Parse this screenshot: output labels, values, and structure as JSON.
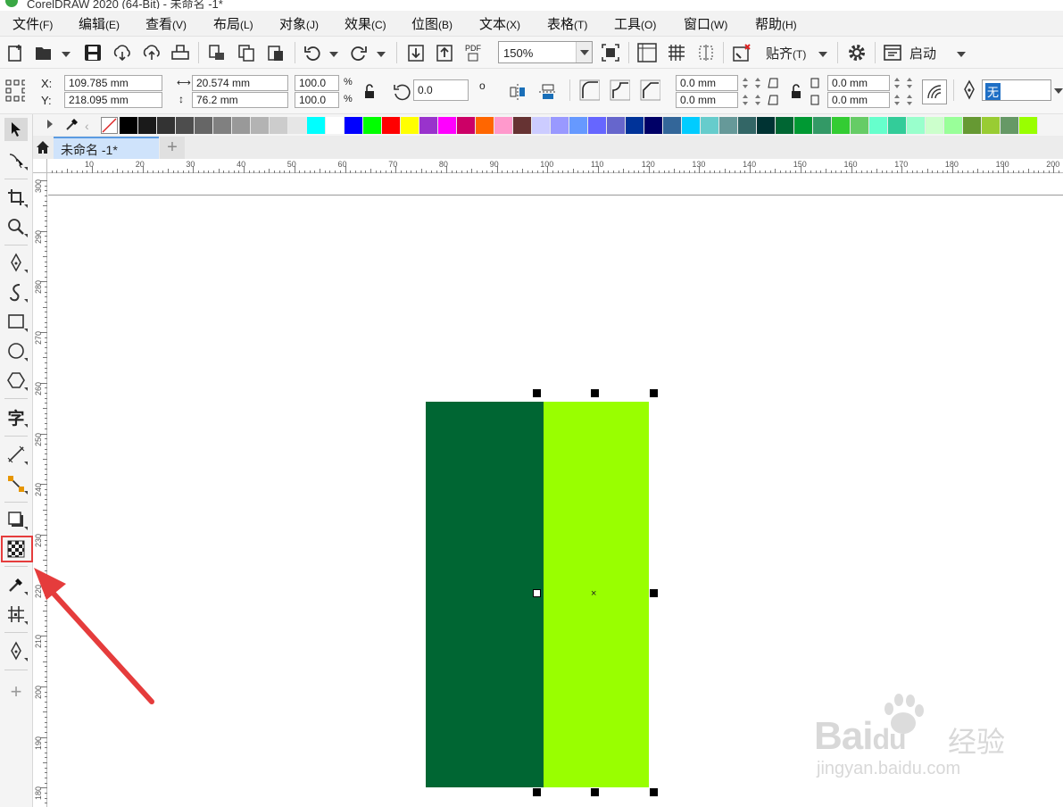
{
  "app": {
    "window_title": "CorelDRAW 2020 (64-Bit) - 未命名 -1*"
  },
  "menu": [
    {
      "label": "文件",
      "accel": "(F)"
    },
    {
      "label": "编辑",
      "accel": "(E)"
    },
    {
      "label": "查看",
      "accel": "(V)"
    },
    {
      "label": "布局",
      "accel": "(L)"
    },
    {
      "label": "对象",
      "accel": "(J)"
    },
    {
      "label": "效果",
      "accel": "(C)"
    },
    {
      "label": "位图",
      "accel": "(B)"
    },
    {
      "label": "文本",
      "accel": "(X)"
    },
    {
      "label": "表格",
      "accel": "(T)"
    },
    {
      "label": "工具",
      "accel": "(O)"
    },
    {
      "label": "窗口",
      "accel": "(W)"
    },
    {
      "label": "帮助",
      "accel": "(H)"
    }
  ],
  "toolbar": {
    "zoom_level": "150%",
    "snap_label": "贴齐",
    "snap_accel": "(T)",
    "launch_label": "启动",
    "pdf_label": "PDF"
  },
  "property_bar": {
    "x_label": "X:",
    "y_label": "Y:",
    "x_value": "109.785 mm",
    "y_value": "218.095 mm",
    "width_value": "20.574 mm",
    "height_value": "76.2 mm",
    "scale_x": "100.0",
    "scale_y": "100.0",
    "percent": "%",
    "rotation": "0.0",
    "degree_symbol": "o",
    "corner_1": "0.0 mm",
    "corner_2": "0.0 mm",
    "corner_3": "0.0 mm",
    "corner_4": "0.0 mm",
    "outline_value": "无"
  },
  "palette": [
    "#000000",
    "#1a1a1a",
    "#333333",
    "#4d4d4d",
    "#666666",
    "#808080",
    "#999999",
    "#b3b3b3",
    "#cccccc",
    "#e6e6e6",
    "#00ffff",
    "#ffffff",
    "#0000ff",
    "#00ff00",
    "#ff0000",
    "#ffff00",
    "#9933cc",
    "#ff00ff",
    "#cc0066",
    "#ff6600",
    "#ff99cc",
    "#663333",
    "#ccccff",
    "#9999ff",
    "#6699ff",
    "#6666ff",
    "#6666cc",
    "#003399",
    "#000066",
    "#336699",
    "#00ccff",
    "#66cccc",
    "#669999",
    "#336666",
    "#003333",
    "#006633",
    "#009933",
    "#339966",
    "#33cc33",
    "#66cc66",
    "#66ffcc",
    "#33cc99",
    "#99ffcc",
    "#ccffcc",
    "#99ff99",
    "#669933",
    "#99cc33",
    "#669966",
    "#99ff00"
  ],
  "document_tab": {
    "title": "未命名 -1*"
  },
  "ruler": {
    "h_labels": [
      "10",
      "20",
      "30",
      "40",
      "50",
      "60",
      "70",
      "80",
      "90",
      "100",
      "110",
      "120",
      "130",
      "140",
      "150",
      "160",
      "170",
      "180",
      "190",
      "200"
    ],
    "v_labels": [
      "300",
      "290",
      "280",
      "270",
      "260",
      "250",
      "240",
      "230",
      "220",
      "210",
      "200",
      "190",
      "180"
    ]
  },
  "canvas_objects": {
    "rect_left_color": "#006633",
    "rect_right_color": "#99ff00",
    "center_mark": "×"
  },
  "watermark": {
    "brand": "Bai",
    "brand2": "du",
    "cn": "经验",
    "url": "jingyan.baidu.com"
  }
}
